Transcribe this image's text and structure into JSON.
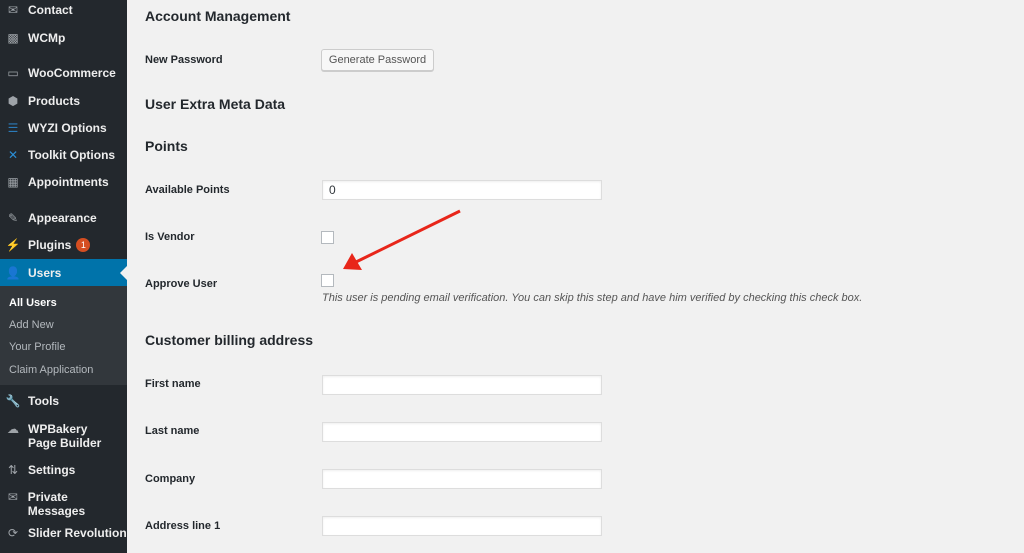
{
  "sidebar": {
    "items": [
      {
        "label": "Contact",
        "icon": "envelope-icon"
      },
      {
        "label": "WCMp",
        "icon": "wcmp-icon"
      },
      {
        "label": "WooCommerce",
        "icon": "woocommerce-icon"
      },
      {
        "label": "Products",
        "icon": "box-icon"
      },
      {
        "label": "WYZI Options",
        "icon": "toggles-icon"
      },
      {
        "label": "Toolkit Options",
        "icon": "tools-cross-icon"
      },
      {
        "label": "Appointments",
        "icon": "calendar-icon"
      },
      {
        "label": "Appearance",
        "icon": "paintbrush-icon"
      },
      {
        "label": "Plugins",
        "icon": "plug-icon",
        "badge": "1"
      },
      {
        "label": "Users",
        "icon": "user-icon",
        "active": true
      },
      {
        "label": "Tools",
        "icon": "wrench-icon"
      },
      {
        "label": "WPBakery Page Builder",
        "icon": "cloud-icon"
      },
      {
        "label": "Settings",
        "icon": "sliders-icon"
      },
      {
        "label": "Private Messages",
        "icon": "envelope-icon"
      },
      {
        "label": "Slider Revolution",
        "icon": "refresh-icon"
      }
    ],
    "submenu": [
      "All Users",
      "Add New",
      "Your Profile",
      "Claim Application"
    ]
  },
  "main": {
    "account_heading": "Account Management",
    "new_password_label": "New Password",
    "generate_password": "Generate Password",
    "extra_meta_heading": "User Extra Meta Data",
    "points_heading": "Points",
    "available_points_label": "Available Points",
    "available_points_value": "0",
    "is_vendor_label": "Is Vendor",
    "approve_user_label": "Approve User",
    "approve_note": "This user is pending email verification. You can skip this step and have him verified by checking this check box.",
    "billing_heading": "Customer billing address",
    "first_name_label": "First name",
    "last_name_label": "Last name",
    "company_label": "Company",
    "address1_label": "Address line 1"
  },
  "colors": {
    "sidebar": "#23282d",
    "active": "#0073aa",
    "arrow": "#e8261a"
  }
}
